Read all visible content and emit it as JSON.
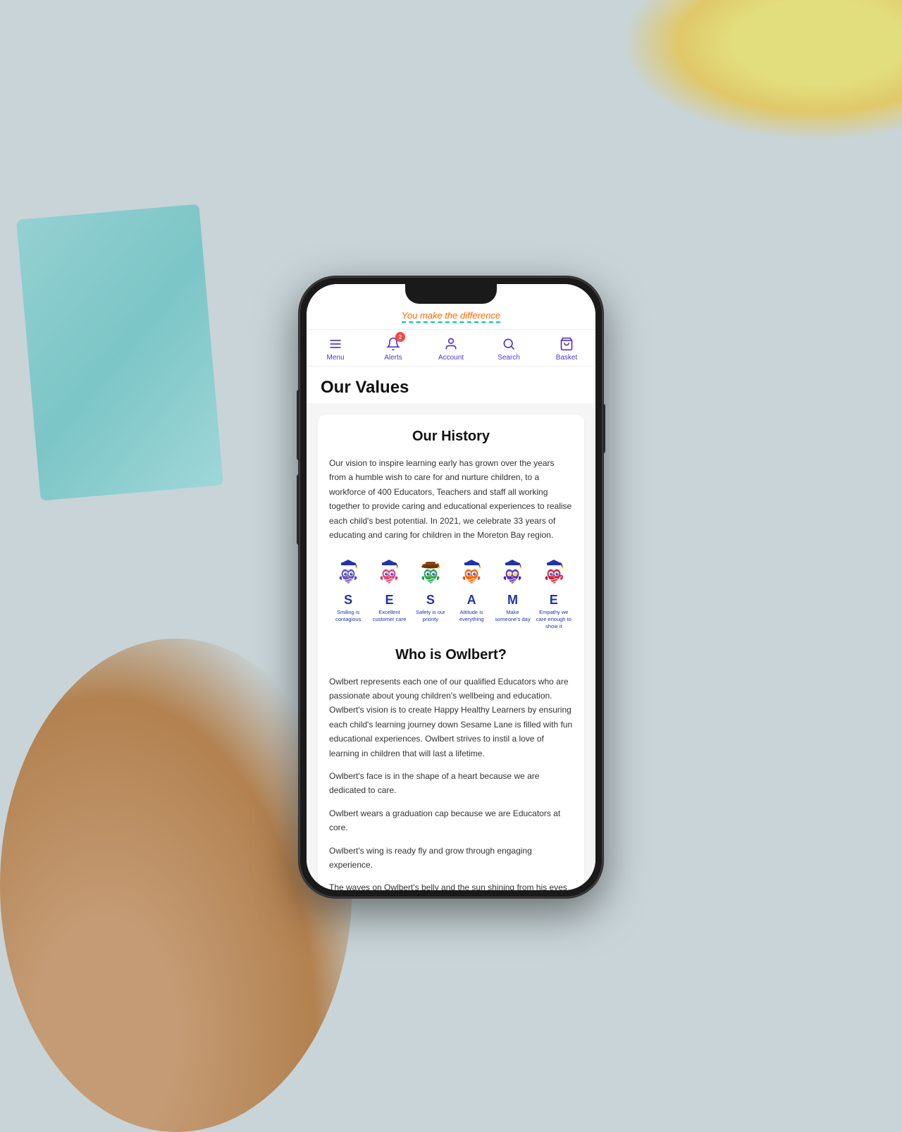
{
  "background": {
    "color": "#c8d4d8"
  },
  "phone": {
    "top_banner": {
      "tagline": "You make the difference"
    },
    "navbar": {
      "items": [
        {
          "id": "menu",
          "label": "Menu",
          "icon": "hamburger-icon",
          "badge": null
        },
        {
          "id": "alerts",
          "label": "Alerts",
          "icon": "bell-icon",
          "badge": "2"
        },
        {
          "id": "account",
          "label": "Account",
          "icon": "person-icon",
          "badge": null
        },
        {
          "id": "search",
          "label": "Search",
          "icon": "search-icon",
          "badge": null
        },
        {
          "id": "basket",
          "label": "Basket",
          "icon": "basket-icon",
          "badge": null
        }
      ]
    },
    "page_title": "Our Values",
    "content": {
      "our_history": {
        "title": "Our History",
        "body": "Our vision to inspire learning early has grown over the years from a humble wish to care for and nurture children, to a workforce of 400 Educators, Teachers and staff all working together to provide caring and educational experiences to realise each child's best potential. In 2021, we celebrate 33 years of educating and caring for children in the Moreton Bay region."
      },
      "seame": {
        "items": [
          {
            "letter": "S",
            "label": "Smiling is contagious",
            "color": "#2233aa"
          },
          {
            "letter": "E",
            "label": "Excellent customer care",
            "color": "#2233aa"
          },
          {
            "letter": "S",
            "label": "Safety is our priority",
            "color": "#2233aa"
          },
          {
            "letter": "A",
            "label": "Attitude is everything",
            "color": "#2233aa"
          },
          {
            "letter": "M",
            "label": "Make someone's day",
            "color": "#2233aa"
          },
          {
            "letter": "E",
            "label": "Empathy we care enough to show it",
            "color": "#2233aa"
          }
        ]
      },
      "who_is_owlbert": {
        "title": "Who is Owlbert?",
        "paragraphs": [
          "Owlbert represents each one of our qualified Educators who are passionate about young children's wellbeing and education. Owlbert's vision is to create Happy Healthy Learners by ensuring each child's learning journey down Sesame Lane is filled with fun educational experiences. Owlbert strives to instil a love of learning in children that will last a lifetime.",
          "Owlbert's face is in the shape of a heart because we are dedicated to care.",
          "Owlbert wears a graduation cap because we are Educators at core.",
          "Owlbert's wing is ready fly and grow through engaging experience.",
          "The waves on Owlbert's belly and the sun shining from his eyes represent our local focus in the Moreton Bay Region."
        ]
      }
    }
  }
}
